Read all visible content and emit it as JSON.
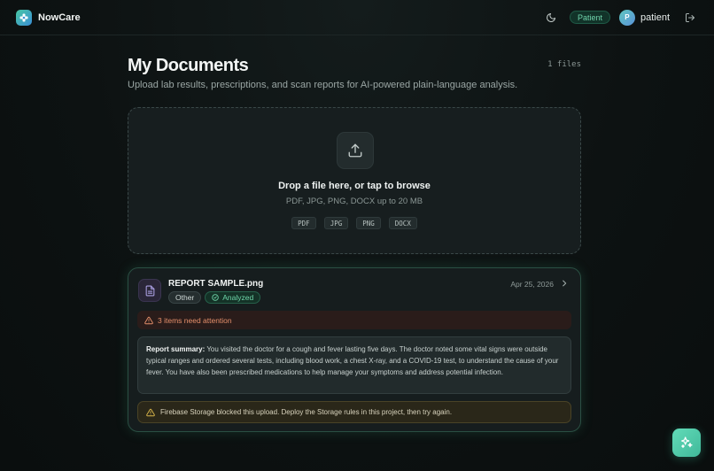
{
  "app": {
    "name": "NowCare"
  },
  "header": {
    "role_badge": "Patient",
    "avatar_initial": "P",
    "username": "patient"
  },
  "page": {
    "title": "My Documents",
    "file_count": "1 files",
    "subtitle": "Upload lab results, prescriptions, and scan reports for AI-powered plain-language analysis."
  },
  "dropzone": {
    "title": "Drop a file here, or tap to browse",
    "hint": "PDF, JPG, PNG, DOCX up to 20 MB",
    "formats": [
      "PDF",
      "JPG",
      "PNG",
      "DOCX"
    ]
  },
  "document": {
    "name": "REPORT SAMPLE.png",
    "category": "Other",
    "status": "Analyzed",
    "date": "Apr 25, 2026",
    "attention": "3 items need attention",
    "summary_label": "Report summary:",
    "summary_text": "You visited the doctor for a cough and fever lasting five days. The doctor noted some vital signs were outside typical ranges and ordered several tests, including blood work, a chest X-ray, and a COVID-19 test, to understand the cause of your fever. You have also been prescribed medications to help manage your symptoms and address potential infection.",
    "warning": "Firebase Storage blocked this upload. Deploy the Storage rules in this project, then try again."
  },
  "colors": {
    "accent": "#49c7a3",
    "attention": "#e58f6b",
    "warning": "#d8b54a"
  },
  "icons": {
    "logo": "nowcare-logo-icon",
    "theme": "moon-icon",
    "logout": "logout-icon",
    "upload": "upload-icon",
    "file": "document-icon",
    "status": "check-circle-icon",
    "chevron": "chevron-right-icon",
    "attention": "warning-triangle-icon",
    "fab": "sparkles-icon"
  }
}
